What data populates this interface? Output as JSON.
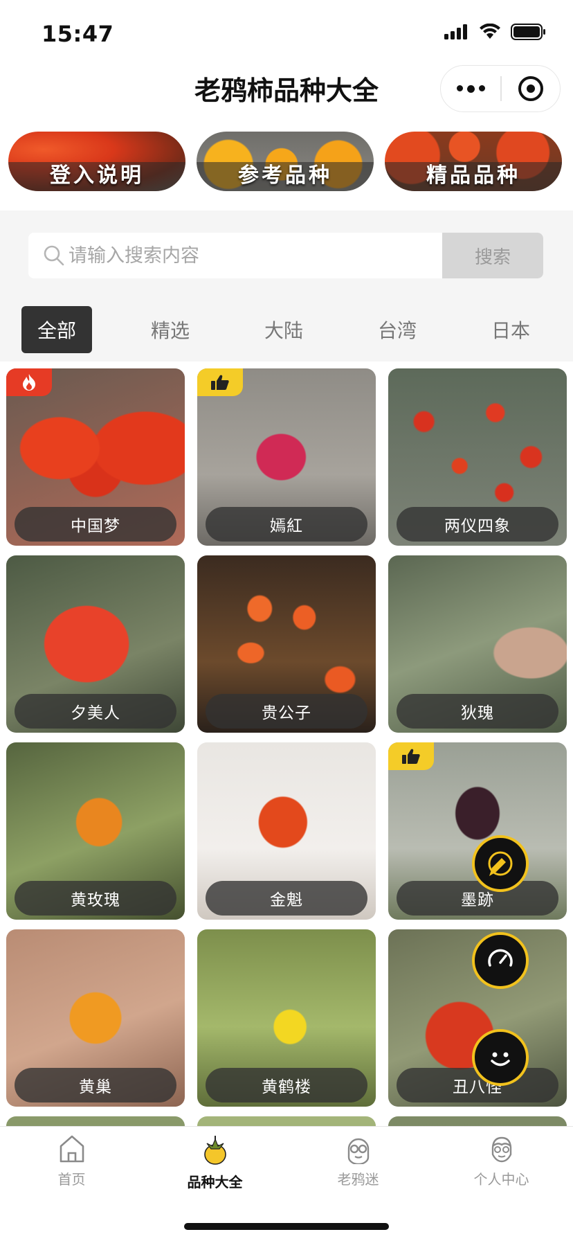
{
  "status_bar": {
    "time": "15:47"
  },
  "nav": {
    "title": "老鸦柿品种大全"
  },
  "banners": [
    {
      "label": "登入说明"
    },
    {
      "label": "参考品种"
    },
    {
      "label": "精品品种"
    }
  ],
  "search": {
    "placeholder": "请输入搜索内容",
    "button_label": "搜索"
  },
  "tabs": [
    {
      "label": "全部",
      "active": true
    },
    {
      "label": "精选",
      "active": false
    },
    {
      "label": "大陆",
      "active": false
    },
    {
      "label": "台湾",
      "active": false
    },
    {
      "label": "日本",
      "active": false
    }
  ],
  "varieties": [
    {
      "name": "中国梦",
      "badge": "hot"
    },
    {
      "name": "嫣紅",
      "badge": "like"
    },
    {
      "name": "两仪四象",
      "badge": ""
    },
    {
      "name": "夕美人",
      "badge": ""
    },
    {
      "name": "贵公子",
      "badge": ""
    },
    {
      "name": "狄瑰",
      "badge": ""
    },
    {
      "name": "黄玫瑰",
      "badge": ""
    },
    {
      "name": "金魁",
      "badge": ""
    },
    {
      "name": "墨跡",
      "badge": "like"
    },
    {
      "name": "黄巢",
      "badge": ""
    },
    {
      "name": "黄鹤楼",
      "badge": ""
    },
    {
      "name": "丑八怪",
      "badge": ""
    }
  ],
  "tabbar": [
    {
      "label": "首页",
      "icon": "home-icon",
      "active": false
    },
    {
      "label": "品种大全",
      "icon": "persimmon-icon",
      "active": true
    },
    {
      "label": "老鸦迷",
      "icon": "glasses-face-icon",
      "active": false
    },
    {
      "label": "个人中心",
      "icon": "user-face-icon",
      "active": false
    }
  ],
  "colors": {
    "accent": "#f2c21d",
    "hot_badge": "#e63b25",
    "like_badge": "#f4cc28",
    "active_tab": "#333333"
  }
}
